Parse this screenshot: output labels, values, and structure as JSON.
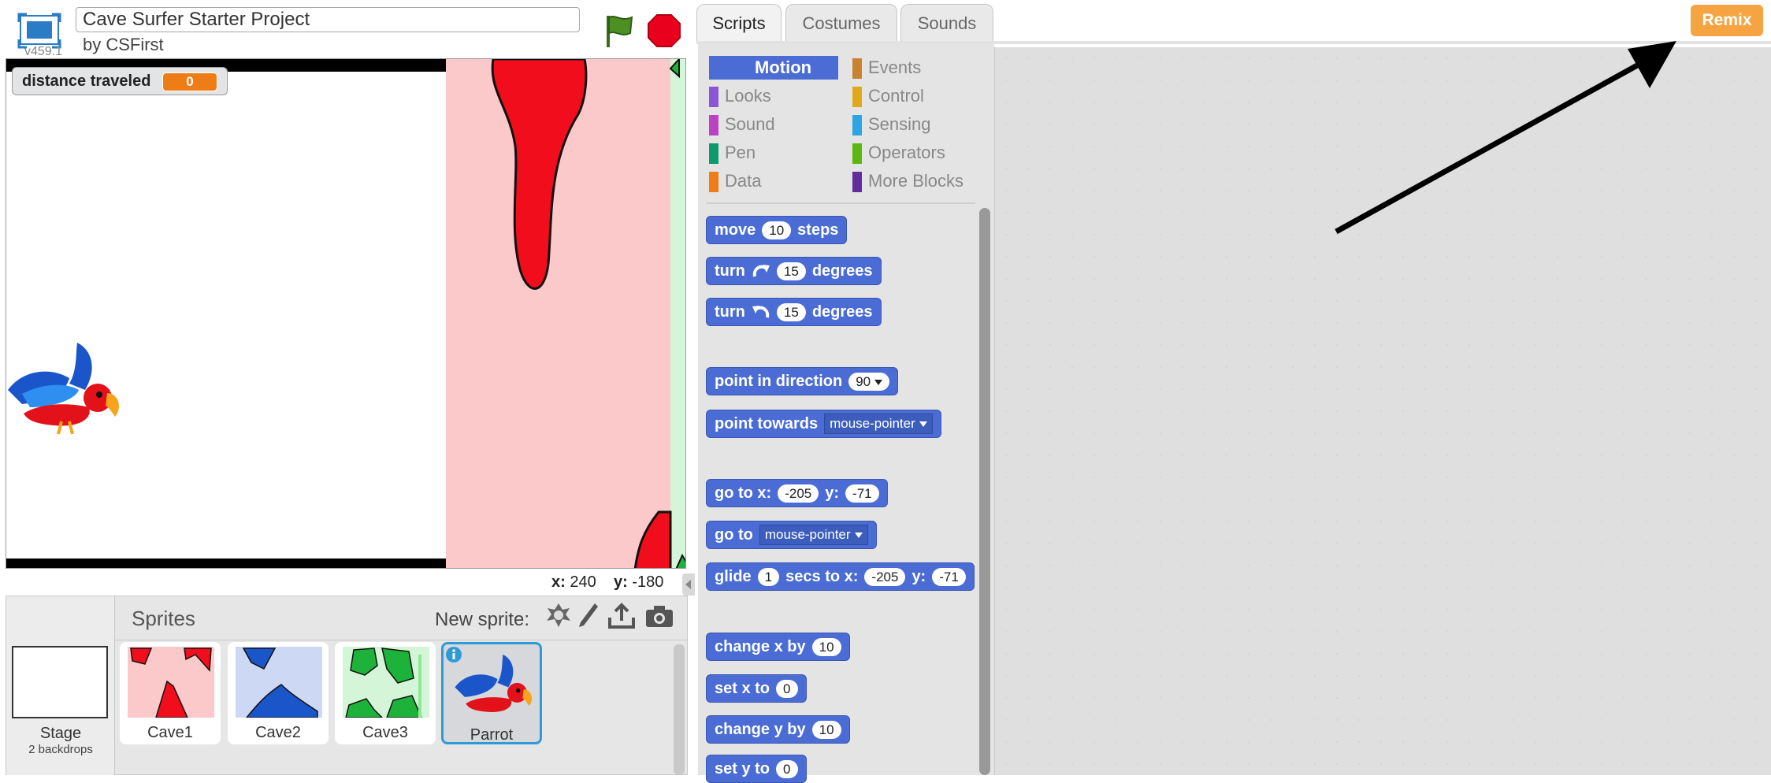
{
  "project": {
    "title": "Cave Surfer Starter Project",
    "author": "by CSFirst",
    "version": "v459.1"
  },
  "monitor": {
    "label": "distance traveled",
    "value": "0"
  },
  "coords": {
    "x_label": "x:",
    "x_value": "240",
    "y_label": "y:",
    "y_value": "-180"
  },
  "sprites_pane": {
    "title": "Sprites",
    "new_sprite_label": "New sprite:",
    "stage": {
      "label": "Stage",
      "sub": "2 backdrops"
    },
    "sprites": [
      {
        "name": "Cave1"
      },
      {
        "name": "Cave2"
      },
      {
        "name": "Cave3"
      },
      {
        "name": "Parrot",
        "selected": true
      }
    ],
    "icons": [
      "paint-from-library-icon",
      "paintbrush-icon",
      "upload-icon",
      "camera-icon"
    ]
  },
  "tabs": [
    {
      "label": "Scripts",
      "active": true
    },
    {
      "label": "Costumes",
      "active": false
    },
    {
      "label": "Sounds",
      "active": false
    }
  ],
  "categories": [
    {
      "label": "Motion",
      "color": "#4a6cd4",
      "selected": true
    },
    {
      "label": "Looks",
      "color": "#8a55d7"
    },
    {
      "label": "Sound",
      "color": "#bb42c3"
    },
    {
      "label": "Pen",
      "color": "#0e9a6c"
    },
    {
      "label": "Data",
      "color": "#ee7d16"
    },
    {
      "label": "Events",
      "color": "#c88330"
    },
    {
      "label": "Control",
      "color": "#e1a91a"
    },
    {
      "label": "Sensing",
      "color": "#2ca5e2"
    },
    {
      "label": "Operators",
      "color": "#5cb712"
    },
    {
      "label": "More Blocks",
      "color": "#632d99"
    }
  ],
  "blocks": {
    "move": {
      "a": "move",
      "v": "10",
      "b": "steps"
    },
    "turn_right": {
      "a": "turn",
      "v": "15",
      "b": "degrees"
    },
    "turn_left": {
      "a": "turn",
      "v": "15",
      "b": "degrees"
    },
    "point_dir": {
      "a": "point in direction",
      "v": "90"
    },
    "point_towards": {
      "a": "point towards",
      "v": "mouse-pointer"
    },
    "goto_xy": {
      "a": "go to x:",
      "x": "-205",
      "b": "y:",
      "y": "-71"
    },
    "goto": {
      "a": "go to",
      "v": "mouse-pointer"
    },
    "glide": {
      "a": "glide",
      "s": "1",
      "b": "secs to x:",
      "x": "-205",
      "c": "y:",
      "y": "-71"
    },
    "change_x": {
      "a": "change x by",
      "v": "10"
    },
    "set_x": {
      "a": "set x to",
      "v": "0"
    },
    "change_y": {
      "a": "change y by",
      "v": "10"
    },
    "set_y": {
      "a": "set y to",
      "v": "0"
    }
  },
  "remix": {
    "label": "Remix",
    "color": "#f6a441"
  }
}
